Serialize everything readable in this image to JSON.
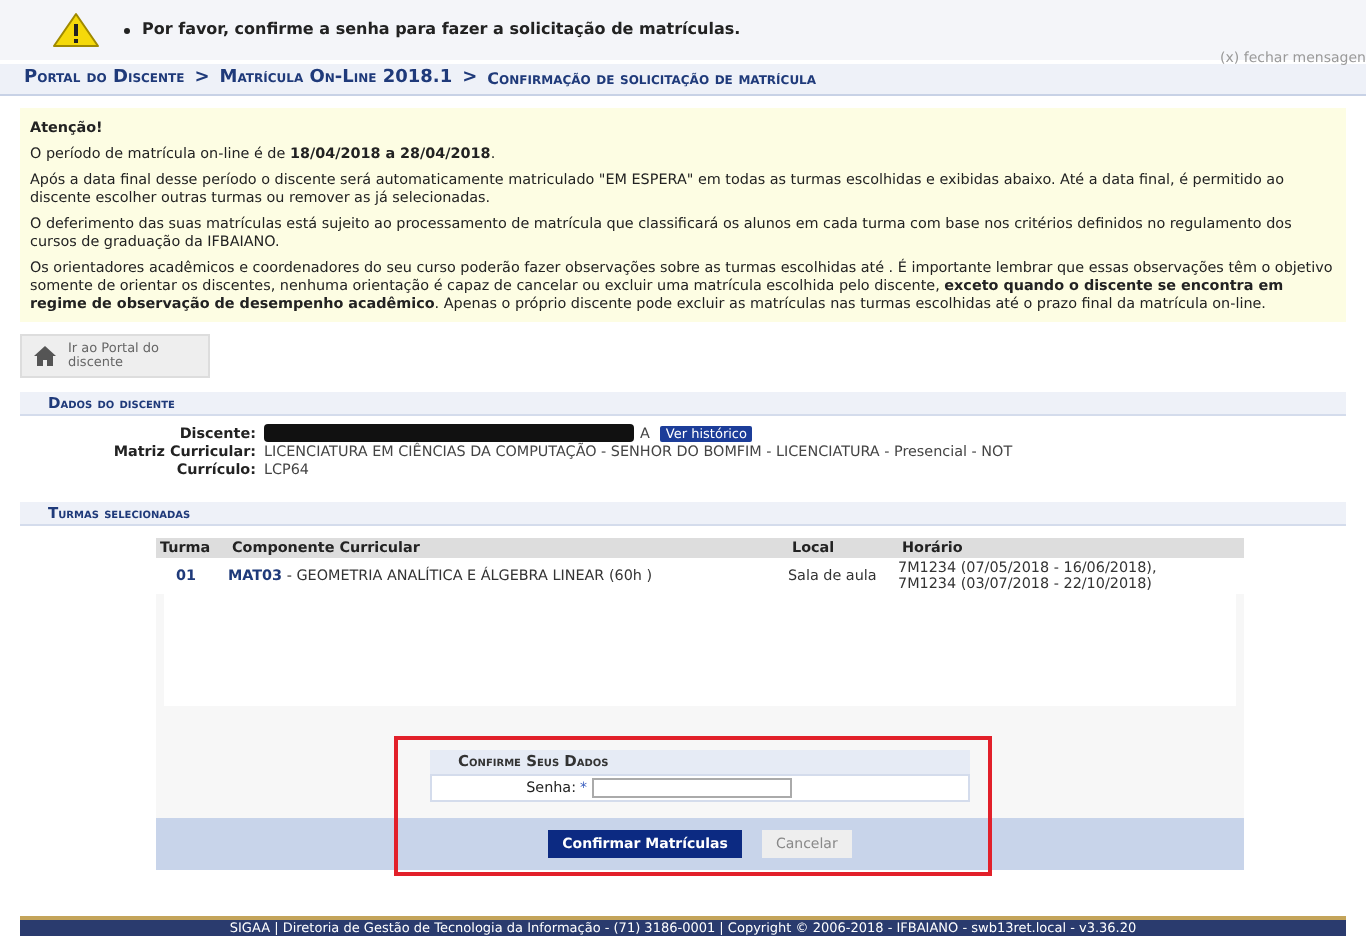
{
  "message": {
    "text": "Por favor, confirme a senha para fazer a solicitação de matrículas.",
    "close": "(x) fechar mensagen"
  },
  "breadcrumb": [
    "Portal do Discente",
    "Matrícula On-Line 2018.1",
    "Confirmação de solicitação de matrícula"
  ],
  "breadcrumb_separators": [
    ">",
    ">"
  ],
  "notice": {
    "title": "Atenção!",
    "paragraphs": [
      "O período de matrícula on-line é de **18/04/2018 a 28/04/2018**.",
      "Após a data final desse período o discente será automaticamente matriculado \"EM ESPERA\" em todas as turmas escolhidas e exibidas abaixo. Até a data final, é permitido ao discente escolher outras turmas ou remover as já selecionadas.",
      "O deferimento das suas matrículas está sujeito ao processamento de matrícula que classificará os alunos em cada turma com base nos critérios definidos no regulamento dos cursos de graduação da IFBAIANO.",
      "Os orientadores acadêmicos e coordenadores do seu curso poderão fazer observações sobre as turmas escolhidas até . É importante lembrar que essas observações têm o objetivo somente de orientar os discentes, nenhuma orientação é capaz de cancelar ou excluir uma matrícula escolhida pelo discente, **exceto quando o discente se encontra em regime de observação de desempenho acadêmico**. Apenas o próprio discente pode excluir as matrículas nas turmas escolhidas até o prazo final da matrícula on-line."
    ]
  },
  "back_button": "Ir ao Portal do discente",
  "student": {
    "header": "Dados do discente",
    "fields": [
      {
        "label": "Discente:",
        "value": "A",
        "kind": "redacted",
        "button": "Ver histórico"
      },
      {
        "label": "Matriz Curricular:",
        "value": "LICENCIATURA EM CIÊNCIAS DA COMPUTAÇÃO - SENHOR DO BOMFIM - LICENCIATURA - Presencial - NOT",
        "kind": "text"
      },
      {
        "label": "Currículo:",
        "value": "LCP64",
        "kind": "text"
      }
    ]
  },
  "classes": {
    "header": "Turmas selecionadas",
    "columns": [
      "Turma",
      "Componente Curricular",
      "Local",
      "Horário"
    ],
    "rows": [
      {
        "turma": "01",
        "code": "MAT03",
        "name": "- GEOMETRIA ANALÍTICA E ÁLGEBRA LINEAR (60h )",
        "local": "Sala de aula",
        "schedule": [
          "7M1234 (07/05/2018 - 16/06/2018),",
          "7M1234 (03/07/2018 - 22/10/2018)"
        ]
      }
    ]
  },
  "confirm": {
    "title": "Confirme Seus Dados",
    "label": "Senha:",
    "required": "*",
    "buttons": [
      {
        "label": "Confirmar Matrículas",
        "disabled": false
      },
      {
        "label": "Cancelar",
        "disabled": true
      }
    ]
  },
  "footer": "SIGAA | Diretoria de Gestão de Tecnologia da Informação - (71) 3186-0001 | Copyright © 2006-2018 - IFBAIANO - swb13ret.local - v3.36.20"
}
